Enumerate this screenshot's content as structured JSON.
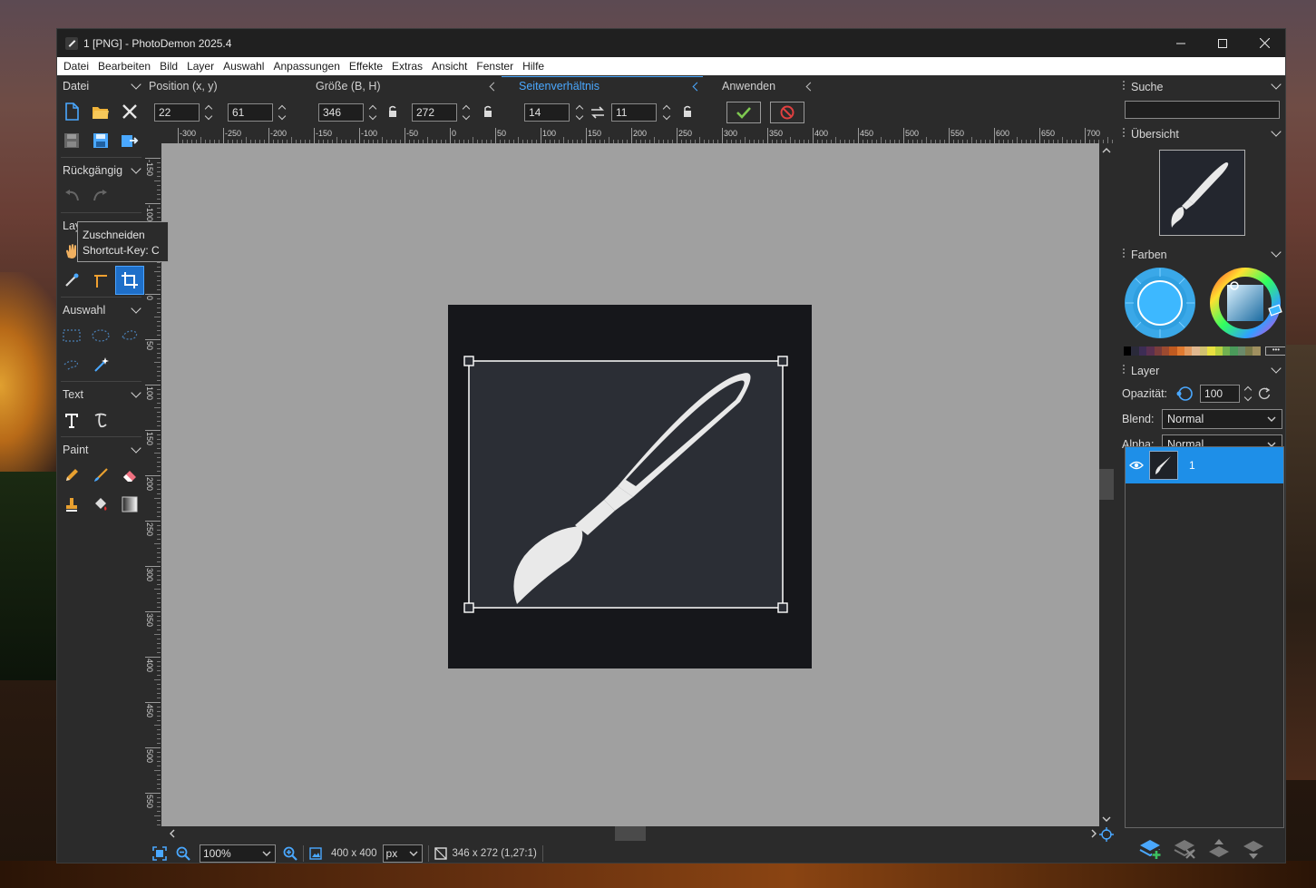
{
  "window": {
    "title": "1 [PNG]  -  PhotoDemon 2025.4"
  },
  "menu": [
    "Datei",
    "Bearbeiten",
    "Bild",
    "Layer",
    "Auswahl",
    "Anpassungen",
    "Effekte",
    "Extras",
    "Ansicht",
    "Fenster",
    "Hilfe"
  ],
  "left": {
    "file_label": "Datei",
    "undo_label": "Rückgängig",
    "layer_label": "Layer",
    "selection_label": "Auswahl",
    "text_label": "Text",
    "paint_label": "Paint"
  },
  "tooltip": {
    "line1": "Zuschneiden",
    "line2": "Shortcut-Key: C"
  },
  "options": {
    "position_label": "Position (x, y)",
    "size_label": "Größe (B, H)",
    "aspect_label": "Seitenverhältnis",
    "apply_label": "Anwenden",
    "x": "22",
    "y": "61",
    "w": "346",
    "h": "272",
    "aspect_w": "14",
    "aspect_h": "11"
  },
  "ruler": {
    "h_labels": [
      "0",
      "-300",
      "-250",
      "-200",
      "-150",
      "-100",
      "-50",
      "0",
      "50",
      "100",
      "150",
      "200",
      "250",
      "300",
      "350",
      "400",
      "450",
      "500",
      "550",
      "600",
      "650",
      "700"
    ],
    "v_labels": [
      "-150",
      "-100",
      "-50",
      "0",
      "50",
      "100",
      "150",
      "200",
      "250",
      "300",
      "350",
      "400",
      "450",
      "500",
      "550"
    ]
  },
  "status": {
    "zoom": "100%",
    "image_size": "400 x 400",
    "unit": "px",
    "selection_info": "346 x 272  (1,27:1)"
  },
  "right": {
    "search_label": "Suche",
    "overview_label": "Übersicht",
    "colors_label": "Farben",
    "layer_label": "Layer",
    "opacity_label": "Opazität:",
    "opacity_value": "100",
    "blend_label": "Blend:",
    "blend_value": "Normal",
    "alpha_label": "Alpha:",
    "alpha_value": "Normal",
    "layer_name": "1"
  },
  "colors": {
    "accent": "#1e8fe8",
    "primary_color": "#3db8ff",
    "palette": [
      "#000000",
      "#2a2a3a",
      "#3d2d55",
      "#5a3050",
      "#7a3c3c",
      "#9c4a30",
      "#c05a20",
      "#e07a30",
      "#e09a60",
      "#e0b890",
      "#d0c070",
      "#e8e040",
      "#b8d040",
      "#70b050",
      "#4a9a5a",
      "#6a8a6a",
      "#7a7a4a",
      "#a09060"
    ]
  }
}
